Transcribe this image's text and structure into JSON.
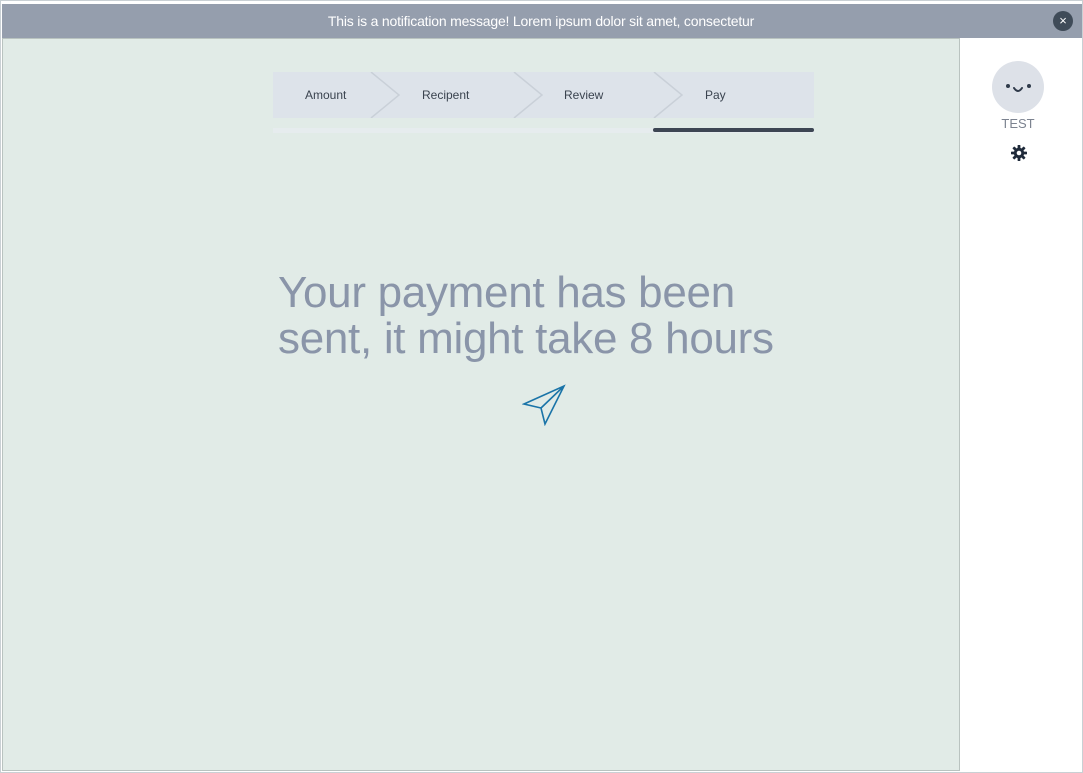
{
  "notification": {
    "message": "This is a notification message! Lorem ipsum dolor sit amet, consectetur",
    "close_label": "×"
  },
  "stepper": {
    "steps": [
      {
        "label": "Amount"
      },
      {
        "label": "Recipent"
      },
      {
        "label": "Review"
      },
      {
        "label": "Pay"
      }
    ],
    "active_step": 4,
    "total_steps": 4
  },
  "main": {
    "headline_line1": "Your payment has been",
    "headline_line2": "sent, it might take 8 hours",
    "icon": "paper-plane-icon"
  },
  "sidebar": {
    "avatar_icon": "smiley-face-icon",
    "username": "TEST",
    "settings_icon": "gear-icon"
  },
  "colors": {
    "notification_bg": "#959ead",
    "main_bg": "#e1ebe7",
    "stepper_bg": "#dde3ea",
    "progress_fill": "#3d4653",
    "headline_text": "#8a95a9",
    "plane_stroke": "#1a74a8"
  }
}
